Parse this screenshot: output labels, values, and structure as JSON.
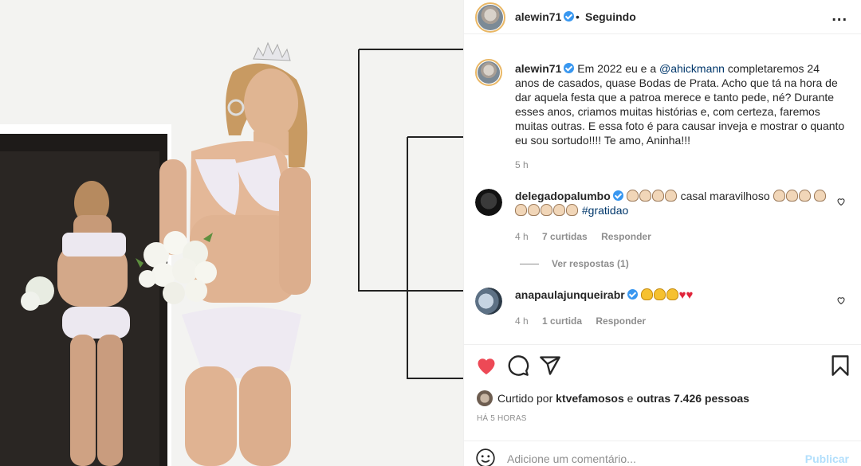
{
  "header": {
    "username": "alewin71",
    "separator": "•",
    "follow_status": "Seguindo",
    "more": "..."
  },
  "caption": {
    "username": "alewin71",
    "text_before": " Em 2022 eu e a ",
    "mention": "@ahickmann",
    "text_after": " completaremos 24 anos de casados, quase Bodas de Prata. Acho que tá na hora de dar aquela festa que a patroa merece e tanto pede, né? Durante esses anos, criamos muitas histórias e, com certeza, faremos muitas outras. E essa foto é para causar inveja e mostrar o quanto eu sou sortudo!!!! Te amo, Aninha!!!",
    "time": "5 h"
  },
  "comments": [
    {
      "username": "delegadopalumbo",
      "text": "casal maravilhoso",
      "hashtag": "#gratidao",
      "time": "4 h",
      "likes": "7 curtidas",
      "reply": "Responder",
      "view_replies": "Ver respostas (1)"
    },
    {
      "username": "anapaulajunqueirabr",
      "time": "4 h",
      "likes": "1 curtida",
      "reply": "Responder"
    }
  ],
  "likes_summary": {
    "prefix": "Curtido por",
    "user": "ktvefamosos",
    "middle": "e",
    "others": "outras 7.426 pessoas"
  },
  "timestamp": "HÁ 5 HORAS",
  "add_comment": {
    "placeholder": "Adicione um comentário...",
    "publish": "Publicar"
  },
  "icons": {
    "like": "heart-filled-icon",
    "comment": "comment-icon",
    "share": "share-icon",
    "save": "bookmark-icon",
    "emoji": "emoji-icon"
  },
  "colors": {
    "like_red": "#ed4956",
    "link": "#00376b",
    "verified": "#3897f0",
    "publish_disabled": "#b2dffc"
  }
}
